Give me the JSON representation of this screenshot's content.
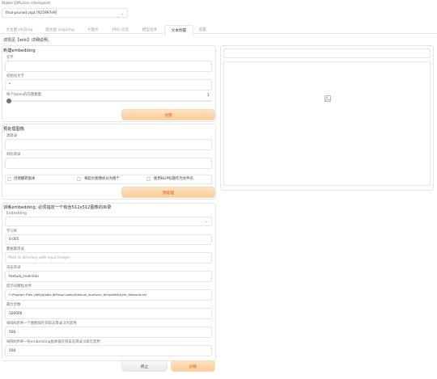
{
  "checkpoint": {
    "label": "Stable Diffusion checkpoint",
    "value": "final-pruned.ckpt [925997e9]"
  },
  "tabs": [
    "文生图 txt2img",
    "图生图 img2img",
    "Al放大",
    "PNG 信息",
    "模型合并",
    "文本倒置",
    "设置"
  ],
  "active_tab_index": 5,
  "info_line": "详情见【wiki】详细说明。",
  "create_embedding": {
    "title": "新建embedding",
    "name_label": "名字",
    "name_value": "",
    "init_text_label": "初始化文字",
    "init_text_value": "*",
    "vectors_label": "每个token的向量数量",
    "vectors_value": "1",
    "vectors_fraction": 0,
    "button": "创建"
  },
  "preprocess": {
    "title": "预处理图像",
    "source_label": "源目录",
    "dest_label": "目标目录",
    "checks": [
      "创建翻转副本",
      "将超大图像拆分为两个",
      "使用BLIP标题作为文件名"
    ],
    "button": "预处理"
  },
  "train": {
    "title": "训练embedding; 必须指定一个有含512x512图像的目录",
    "embedding_label": "Embedding",
    "embedding_value": "",
    "lr_label": "学习率",
    "lr_value": "0.005",
    "dataset_label": "数据集目录",
    "dataset_placeholder": "Path to directory with input images",
    "log_label": "日志目录",
    "log_value": "textual_inversion",
    "prompt_label": "提示词模板文件",
    "prompt_value": "F:\\Program Files (x86)\\stable-diffusion-webui\\textual_inversion_templates\\style_filewords.txt",
    "steps_label": "最大步数",
    "steps_value": "100000",
    "save_img_label": "每隔N步将一个图像保存到日志目录,0为禁用",
    "save_img_value": "500",
    "save_emb_label": "每隔N步将一份embedding副本保存到日志目录,0表示禁用",
    "save_emb_value": "500",
    "stop_button": "终止",
    "train_button": "训练"
  },
  "output": {
    "image_icon": "image-placeholder-icon"
  },
  "colors": {
    "accent": "#ea580c",
    "button_orange": "#fbcc98",
    "border": "#e5e7eb"
  }
}
